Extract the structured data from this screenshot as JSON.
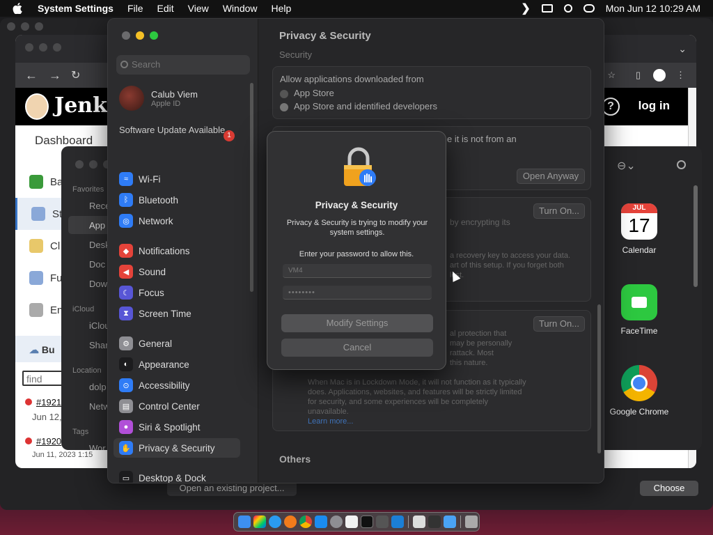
{
  "menubar": {
    "app": "System Settings",
    "items": [
      "File",
      "Edit",
      "View",
      "Window",
      "Help"
    ],
    "datetime": "Mon Jun 12  10:29 AM"
  },
  "jenkins": {
    "title": "Jenki",
    "login": "log in",
    "dashboard": "Dashboard",
    "help": "?",
    "side": [
      "Ba",
      "St",
      "Cl",
      "Fu",
      "En"
    ],
    "build_section": "Bu",
    "find_placeholder": "find",
    "builds": [
      {
        "id": "#1921",
        "date": "Jun 12,"
      },
      {
        "id": "#1920",
        "date": "Jun 11, 2023 1:15"
      }
    ]
  },
  "finder": {
    "favorites": "Favorites",
    "fav_items": [
      "Rece",
      "App",
      "Desk",
      "Doc",
      "Dow"
    ],
    "icloud": "iCloud",
    "icloud_items": [
      "iClou",
      "Shar"
    ],
    "locations": "Location",
    "loc_items": [
      "dolp",
      "Netw"
    ],
    "tags": "Tags",
    "tag_items": [
      "Wor"
    ]
  },
  "applist": {
    "apps": [
      {
        "name": "Calendar",
        "month": "JUL",
        "day": "17"
      },
      {
        "name": "FaceTime"
      },
      {
        "name": "Google Chrome"
      }
    ]
  },
  "xcode": {
    "open_project": "Open an existing project...",
    "choose": "Choose"
  },
  "settings": {
    "search_placeholder": "Search",
    "user": {
      "name": "Calub Viem",
      "sub": "Apple ID"
    },
    "software_update": {
      "label": "Software Update Available",
      "badge": "1"
    },
    "sidebar": [
      {
        "label": "Wi-Fi",
        "icon": "wifi-icon",
        "color": "#2f7cf6",
        "glyph": "≈"
      },
      {
        "label": "Bluetooth",
        "icon": "bluetooth-icon",
        "color": "#2f7cf6",
        "glyph": "ᛒ"
      },
      {
        "label": "Network",
        "icon": "globe-icon",
        "color": "#2f7cf6",
        "glyph": "◎"
      },
      {
        "label": "Notifications",
        "icon": "bell-icon",
        "color": "#e5433a",
        "glyph": "◆"
      },
      {
        "label": "Sound",
        "icon": "speaker-icon",
        "color": "#e5433a",
        "glyph": "◀"
      },
      {
        "label": "Focus",
        "icon": "moon-icon",
        "color": "#5856d6",
        "glyph": "☾"
      },
      {
        "label": "Screen Time",
        "icon": "hourglass-icon",
        "color": "#5856d6",
        "glyph": "⧗"
      },
      {
        "label": "General",
        "icon": "gear-icon",
        "color": "#8e8e93",
        "glyph": "⚙"
      },
      {
        "label": "Appearance",
        "icon": "appearance-icon",
        "color": "#1c1c1e",
        "glyph": "◐"
      },
      {
        "label": "Accessibility",
        "icon": "accessibility-icon",
        "color": "#2f7cf6",
        "glyph": "⊙"
      },
      {
        "label": "Control Center",
        "icon": "control-center-icon",
        "color": "#8e8e93",
        "glyph": "▤"
      },
      {
        "label": "Siri & Spotlight",
        "icon": "siri-icon",
        "color": "#b14fd8",
        "glyph": "●"
      },
      {
        "label": "Privacy & Security",
        "icon": "hand-icon",
        "color": "#2f7cf6",
        "glyph": "✋"
      },
      {
        "label": "Desktop & Dock",
        "icon": "dock-icon",
        "color": "#1c1c1e",
        "glyph": "▭"
      }
    ],
    "content": {
      "title": "Privacy & Security",
      "section": "Security",
      "allow_label": "Allow applications downloaded from",
      "opt1": "App Store",
      "opt2": "App Store and identified developers",
      "blocked_text": "e it is not from an",
      "open_anyway": "Open Anyway",
      "turn_on": "Turn On...",
      "filevault_a": "by encrypting its",
      "filevault_b": "a recovery key to access your data.",
      "filevault_c": "art of this setup. If you forget both",
      "filevault_d": "lost.",
      "lockdown_a": "al protection that",
      "lockdown_b": "may be personally",
      "lockdown_c": "rattack. Most",
      "lockdown_d": "this nature.",
      "lockdown_desc": "When Mac is in Lockdown Mode, it will not function as it typically does. Applications, websites, and features will be strictly limited for security, and some experiences will be completely unavailable.",
      "learn_more": "Learn more...",
      "others": "Others"
    }
  },
  "dialog": {
    "title": "Privacy & Security",
    "message": "Privacy & Security is trying to modify your system settings.",
    "ask": "Enter your password to allow this.",
    "username": "VM4",
    "password": "••••••••",
    "modify": "Modify Settings",
    "cancel": "Cancel"
  }
}
